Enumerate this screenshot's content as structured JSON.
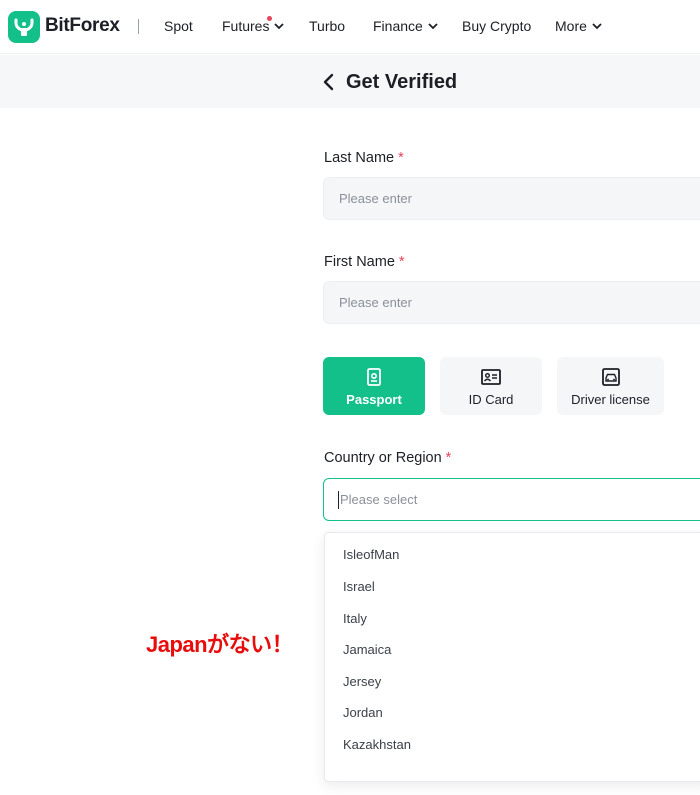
{
  "brand": {
    "name": "BitForex"
  },
  "nav": {
    "items": [
      {
        "label": "Spot"
      },
      {
        "label": "Futures"
      },
      {
        "label": "Turbo"
      },
      {
        "label": "Finance"
      },
      {
        "label": "Buy Crypto"
      },
      {
        "label": "More"
      }
    ]
  },
  "header": {
    "title": "Get Verified"
  },
  "form": {
    "last_name": {
      "label": "Last Name",
      "required": "*",
      "placeholder": "Please enter"
    },
    "first_name": {
      "label": "First Name",
      "required": "*",
      "placeholder": "Please enter"
    },
    "doc_types": [
      {
        "label": "Passport",
        "icon": "passport-icon",
        "selected": true
      },
      {
        "label": "ID Card",
        "icon": "id-card-icon",
        "selected": false
      },
      {
        "label": "Driver license",
        "icon": "car-icon",
        "selected": false
      }
    ],
    "country": {
      "label": "Country or Region",
      "required": "*",
      "placeholder": "Please select"
    }
  },
  "dropdown": {
    "options": [
      "IsleofMan",
      "Israel",
      "Italy",
      "Jamaica",
      "Jersey",
      "Jordan",
      "Kazakhstan"
    ]
  },
  "annotation": {
    "text": "Japanがない！"
  },
  "colors": {
    "accent": "#14c08a",
    "required": "#e8445a",
    "annotation": "#e80c0c"
  }
}
